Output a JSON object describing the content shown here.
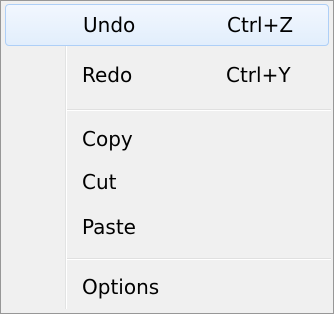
{
  "menu": {
    "items": [
      {
        "label": "Undo",
        "shortcut": "Ctrl+Z"
      },
      {
        "label": "Redo",
        "shortcut": "Ctrl+Y"
      },
      {
        "label": "Copy"
      },
      {
        "label": "Cut"
      },
      {
        "label": "Paste"
      },
      {
        "label": "Options"
      }
    ]
  },
  "colors": {
    "background": "#f0f0f0",
    "border": "#979797",
    "highlight_border": "#aecff7",
    "highlight_fill": "#e2eefc"
  }
}
